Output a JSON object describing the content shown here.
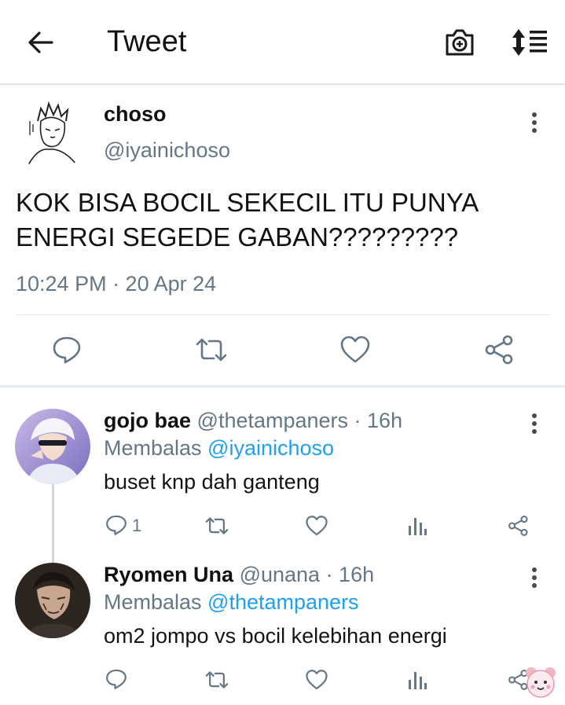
{
  "header": {
    "title": "Tweet",
    "back_icon": "arrow-left-icon",
    "camera_icon": "camera-plus-icon",
    "sort_icon": "sort-list-icon"
  },
  "tweet": {
    "author_name": "choso",
    "handle": "@iyainichoso",
    "text": "KOK BISA BOCIL SEKECIL ITU PUNYA ENERGI SEGEDE GABAN?????????",
    "timestamp": "10:24 PM · 20 Apr 24"
  },
  "replies": [
    {
      "name": "gojo bae",
      "handle": "@thetampaners",
      "time": " · 16h",
      "replying_label": "Membalas ",
      "replying_to": "@iyainichoso",
      "text": "buset knp dah ganteng",
      "reply_count": "1"
    },
    {
      "name": "Ryomen Una",
      "handle": "@unana",
      "time": " · 16h",
      "replying_label": "Membalas ",
      "replying_to": "@thetampaners",
      "text": "om2 jompo vs bocil kelebihan energi",
      "reply_count": ""
    }
  ],
  "colors": {
    "link": "#1da1f2",
    "secondary_text": "#657786",
    "icon": "#657786"
  }
}
